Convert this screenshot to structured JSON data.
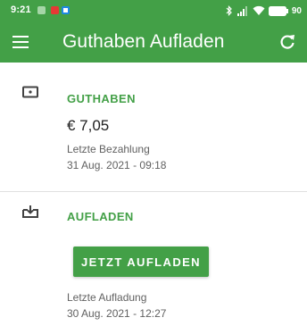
{
  "status_bar": {
    "time": "9:21",
    "battery": "90"
  },
  "app_bar": {
    "title": "Guthaben Aufladen",
    "menu_icon": "hamburger-menu-icon",
    "refresh_icon": "refresh-icon"
  },
  "balance_section": {
    "icon": "wallet-card-icon",
    "title": "GUTHABEN",
    "amount": "€ 7,05",
    "last_payment_label": "Letzte Bezahlung",
    "last_payment_date": "31 Aug. 2021 - 09:18"
  },
  "topup_section": {
    "icon": "topup-tray-icon",
    "title": "AUFLADEN",
    "button_label": "JETZT AUFLADEN",
    "last_topup_label": "Letzte Aufladung",
    "last_topup_date": "30 Aug. 2021 - 12:27"
  },
  "colors": {
    "primary": "#43a047",
    "text_primary": "#212121",
    "text_secondary": "#616161",
    "divider": "#e0e0e0"
  }
}
